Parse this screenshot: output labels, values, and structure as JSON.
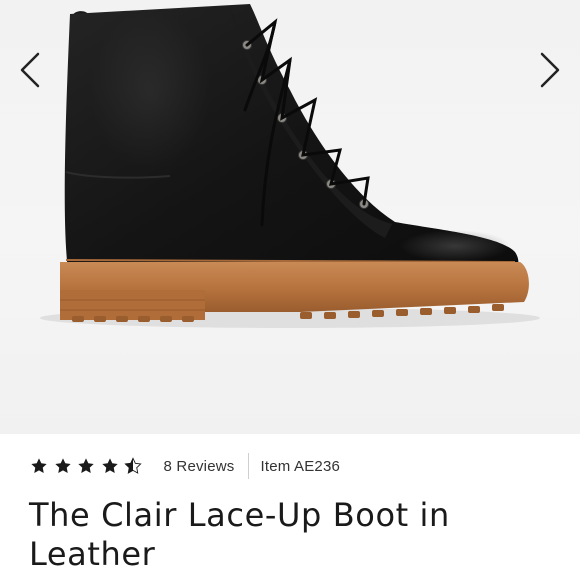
{
  "gallery": {
    "prev_icon": "chevron-left-icon",
    "next_icon": "chevron-right-icon",
    "image_subject": "black leather lace-up boot with gum lug sole"
  },
  "product": {
    "rating": 4.5,
    "rating_max": 5,
    "reviews_label": "8 Reviews",
    "item_label": "Item AE236",
    "title": "The Clair Lace-Up Boot in Leather"
  },
  "colors": {
    "star": "#1a1a1a",
    "text": "#1a1a1a",
    "background": "#ffffff"
  }
}
